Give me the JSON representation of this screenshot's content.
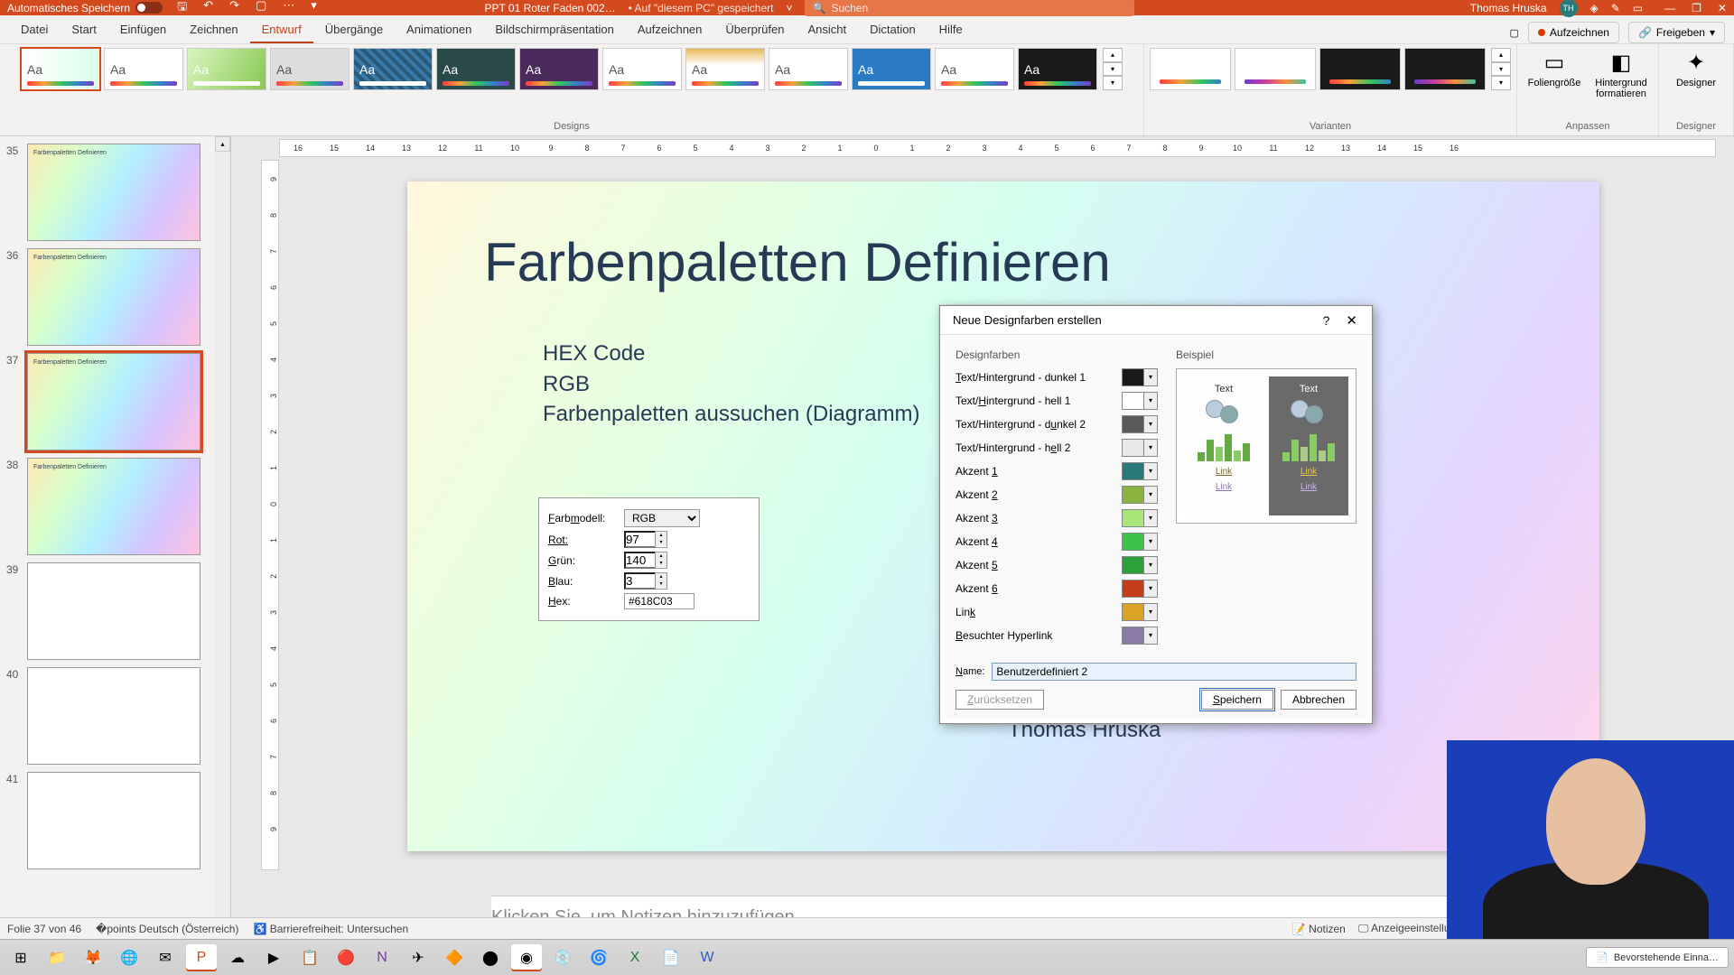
{
  "titlebar": {
    "autosave_label": "Automatisches Speichern",
    "doc_name": "PPT 01 Roter Faden 002…",
    "doc_saved": "• Auf \"diesem PC\" gespeichert",
    "search_placeholder": "Suchen",
    "user_name": "Thomas Hruska",
    "user_initials": "TH"
  },
  "ribbon_tabs": [
    "Datei",
    "Start",
    "Einfügen",
    "Zeichnen",
    "Entwurf",
    "Übergänge",
    "Animationen",
    "Bildschirmpräsentation",
    "Aufzeichnen",
    "Überprüfen",
    "Ansicht",
    "Dictation",
    "Hilfe"
  ],
  "active_tab_index": 4,
  "ribbon_right": {
    "record": "Aufzeichnen",
    "share": "Freigeben"
  },
  "ribbon_groups": {
    "designs": "Designs",
    "varianten": "Varianten",
    "anpassen": "Anpassen",
    "designer": "Designer",
    "foliengroesse": "Foliengröße",
    "hintergrund": "Hintergrund formatieren",
    "designer_btn": "Designer"
  },
  "thumbnails": [
    {
      "num": "35",
      "title": "Farbenpaletten Definieren",
      "rainbow": true
    },
    {
      "num": "36",
      "title": "Farbenpaletten Definieren",
      "rainbow": true
    },
    {
      "num": "37",
      "title": "Farbenpaletten Definieren",
      "rainbow": true,
      "selected": true
    },
    {
      "num": "38",
      "title": "Farbenpaletten Definieren",
      "rainbow": true
    },
    {
      "num": "39",
      "title": "",
      "rainbow": false
    },
    {
      "num": "40",
      "title": "",
      "rainbow": false
    },
    {
      "num": "41",
      "title": "",
      "rainbow": false
    }
  ],
  "slide": {
    "title": "Farbenpaletten Definieren",
    "bullets": [
      "HEX Code",
      "RGB",
      "Farbenpaletten aussuchen (Diagramm)"
    ],
    "author": "Thomas Hruska",
    "rgb_panel": {
      "model_label": "Farbmodell:",
      "model_value": "RGB",
      "rot_label": "Rot:",
      "rot_value": "97",
      "gruen_label": "Grün:",
      "gruen_value": "140",
      "blau_label": "Blau:",
      "blau_value": "3",
      "hex_label": "Hex:",
      "hex_value": "#618C03"
    }
  },
  "notes_placeholder": "Klicken Sie, um Notizen hinzuzufügen",
  "dialog": {
    "title": "Neue Designfarben erstellen",
    "section_left": "Designfarben",
    "section_right": "Beispiel",
    "rows": [
      {
        "label_pre": "",
        "u": "T",
        "label_post": "ext/Hintergrund - dunkel 1",
        "color": "#1a1a1a"
      },
      {
        "label_pre": "Text/",
        "u": "H",
        "label_post": "intergrund - hell 1",
        "color": "#ffffff"
      },
      {
        "label_pre": "Text/Hintergrund - d",
        "u": "u",
        "label_post": "nkel 2",
        "color": "#5a5a5a"
      },
      {
        "label_pre": "Text/Hintergrund - h",
        "u": "e",
        "label_post": "ll 2",
        "color": "#e8e8e8"
      },
      {
        "label_pre": "Akzent ",
        "u": "1",
        "label_post": "",
        "color": "#2b7a7a"
      },
      {
        "label_pre": "Akzent ",
        "u": "2",
        "label_post": "",
        "color": "#8ab43c"
      },
      {
        "label_pre": "Akzent ",
        "u": "3",
        "label_post": "",
        "color": "#a8e67a"
      },
      {
        "label_pre": "Akzent ",
        "u": "4",
        "label_post": "",
        "color": "#3cc44a"
      },
      {
        "label_pre": "Akzent ",
        "u": "5",
        "label_post": "",
        "color": "#2aa038"
      },
      {
        "label_pre": "Akzent ",
        "u": "6",
        "label_post": "",
        "color": "#c43e1c"
      },
      {
        "label_pre": "Lin",
        "u": "k",
        "label_post": "",
        "color": "#d9a326"
      },
      {
        "label_pre": "",
        "u": "B",
        "label_post": "esuchter Hyperlink",
        "color": "#8a7aa8"
      }
    ],
    "preview_text": "Text",
    "preview_link": "Link",
    "name_label": "Name:",
    "name_value": "Benutzerdefiniert 2",
    "btn_reset": "Zurücksetzen",
    "btn_save": "Speichern",
    "btn_cancel": "Abbrechen"
  },
  "status": {
    "slide": "Folie 37 von 46",
    "lang": "Deutsch (Österreich)",
    "access": "Barrierefreiheit: Untersuchen",
    "notizen": "Notizen",
    "anzeige": "Anzeigeeinstellungen"
  },
  "taskbar_tray": {
    "doc": "Bevorstehende Einna…"
  },
  "ruler_h": [
    "16",
    "15",
    "14",
    "13",
    "12",
    "11",
    "10",
    "9",
    "8",
    "7",
    "6",
    "5",
    "4",
    "3",
    "2",
    "1",
    "0",
    "1",
    "2",
    "3",
    "4",
    "5",
    "6",
    "7",
    "8",
    "9",
    "10",
    "11",
    "12",
    "13",
    "14",
    "15",
    "16"
  ],
  "ruler_v": [
    "9",
    "8",
    "7",
    "6",
    "5",
    "4",
    "3",
    "2",
    "1",
    "0",
    "1",
    "2",
    "3",
    "4",
    "5",
    "6",
    "7",
    "8",
    "9"
  ]
}
